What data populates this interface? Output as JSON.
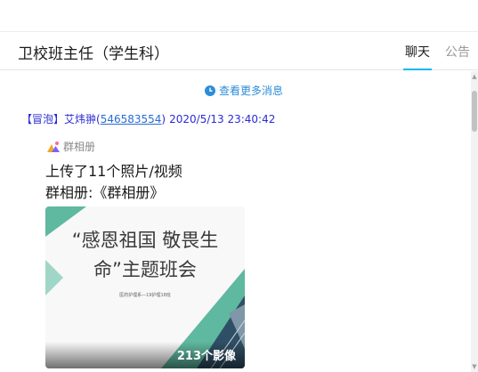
{
  "header": {
    "title": "卫校班主任（学生科）",
    "tabs": [
      {
        "label": "聊天",
        "active": true
      },
      {
        "label": "公告",
        "active": false
      }
    ]
  },
  "chat": {
    "more_messages": "查看更多消息",
    "message": {
      "tag": "【冒泡】",
      "sender": "艾炜翀(",
      "qq": "546583554",
      "close_paren": ")",
      "time": "2020/5/13 23:40:42",
      "album_label": "群相册",
      "line1": "上传了11个照片/视频",
      "line2": "群相册:《群相册》",
      "thumbnail": {
        "title_line1": "“感恩祖国 敬畏生",
        "title_line2": "命”主题班会",
        "subtitle": "医药护理系—19护理18班",
        "count": "213个影像"
      }
    }
  },
  "colors": {
    "accent": "#12b7f5",
    "link": "#2d8cdb",
    "sender": "#2b2bd3",
    "thumb_green": "#5fb8a0"
  }
}
